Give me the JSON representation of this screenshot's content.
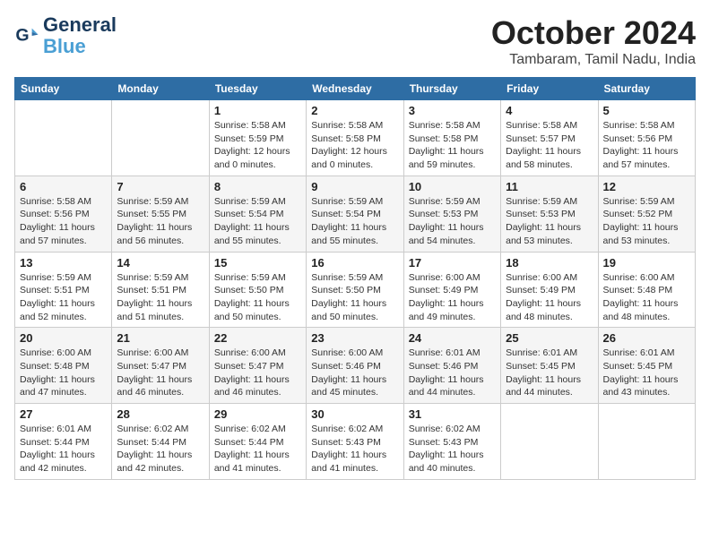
{
  "header": {
    "logo_line1": "General",
    "logo_line2": "Blue",
    "month_title": "October 2024",
    "location": "Tambaram, Tamil Nadu, India"
  },
  "weekdays": [
    "Sunday",
    "Monday",
    "Tuesday",
    "Wednesday",
    "Thursday",
    "Friday",
    "Saturday"
  ],
  "weeks": [
    [
      {
        "day": "",
        "sunrise": "",
        "sunset": "",
        "daylight": ""
      },
      {
        "day": "",
        "sunrise": "",
        "sunset": "",
        "daylight": ""
      },
      {
        "day": "1",
        "sunrise": "Sunrise: 5:58 AM",
        "sunset": "Sunset: 5:59 PM",
        "daylight": "Daylight: 12 hours and 0 minutes."
      },
      {
        "day": "2",
        "sunrise": "Sunrise: 5:58 AM",
        "sunset": "Sunset: 5:58 PM",
        "daylight": "Daylight: 12 hours and 0 minutes."
      },
      {
        "day": "3",
        "sunrise": "Sunrise: 5:58 AM",
        "sunset": "Sunset: 5:58 PM",
        "daylight": "Daylight: 11 hours and 59 minutes."
      },
      {
        "day": "4",
        "sunrise": "Sunrise: 5:58 AM",
        "sunset": "Sunset: 5:57 PM",
        "daylight": "Daylight: 11 hours and 58 minutes."
      },
      {
        "day": "5",
        "sunrise": "Sunrise: 5:58 AM",
        "sunset": "Sunset: 5:56 PM",
        "daylight": "Daylight: 11 hours and 57 minutes."
      }
    ],
    [
      {
        "day": "6",
        "sunrise": "Sunrise: 5:58 AM",
        "sunset": "Sunset: 5:56 PM",
        "daylight": "Daylight: 11 hours and 57 minutes."
      },
      {
        "day": "7",
        "sunrise": "Sunrise: 5:59 AM",
        "sunset": "Sunset: 5:55 PM",
        "daylight": "Daylight: 11 hours and 56 minutes."
      },
      {
        "day": "8",
        "sunrise": "Sunrise: 5:59 AM",
        "sunset": "Sunset: 5:54 PM",
        "daylight": "Daylight: 11 hours and 55 minutes."
      },
      {
        "day": "9",
        "sunrise": "Sunrise: 5:59 AM",
        "sunset": "Sunset: 5:54 PM",
        "daylight": "Daylight: 11 hours and 55 minutes."
      },
      {
        "day": "10",
        "sunrise": "Sunrise: 5:59 AM",
        "sunset": "Sunset: 5:53 PM",
        "daylight": "Daylight: 11 hours and 54 minutes."
      },
      {
        "day": "11",
        "sunrise": "Sunrise: 5:59 AM",
        "sunset": "Sunset: 5:53 PM",
        "daylight": "Daylight: 11 hours and 53 minutes."
      },
      {
        "day": "12",
        "sunrise": "Sunrise: 5:59 AM",
        "sunset": "Sunset: 5:52 PM",
        "daylight": "Daylight: 11 hours and 53 minutes."
      }
    ],
    [
      {
        "day": "13",
        "sunrise": "Sunrise: 5:59 AM",
        "sunset": "Sunset: 5:51 PM",
        "daylight": "Daylight: 11 hours and 52 minutes."
      },
      {
        "day": "14",
        "sunrise": "Sunrise: 5:59 AM",
        "sunset": "Sunset: 5:51 PM",
        "daylight": "Daylight: 11 hours and 51 minutes."
      },
      {
        "day": "15",
        "sunrise": "Sunrise: 5:59 AM",
        "sunset": "Sunset: 5:50 PM",
        "daylight": "Daylight: 11 hours and 50 minutes."
      },
      {
        "day": "16",
        "sunrise": "Sunrise: 5:59 AM",
        "sunset": "Sunset: 5:50 PM",
        "daylight": "Daylight: 11 hours and 50 minutes."
      },
      {
        "day": "17",
        "sunrise": "Sunrise: 6:00 AM",
        "sunset": "Sunset: 5:49 PM",
        "daylight": "Daylight: 11 hours and 49 minutes."
      },
      {
        "day": "18",
        "sunrise": "Sunrise: 6:00 AM",
        "sunset": "Sunset: 5:49 PM",
        "daylight": "Daylight: 11 hours and 48 minutes."
      },
      {
        "day": "19",
        "sunrise": "Sunrise: 6:00 AM",
        "sunset": "Sunset: 5:48 PM",
        "daylight": "Daylight: 11 hours and 48 minutes."
      }
    ],
    [
      {
        "day": "20",
        "sunrise": "Sunrise: 6:00 AM",
        "sunset": "Sunset: 5:48 PM",
        "daylight": "Daylight: 11 hours and 47 minutes."
      },
      {
        "day": "21",
        "sunrise": "Sunrise: 6:00 AM",
        "sunset": "Sunset: 5:47 PM",
        "daylight": "Daylight: 11 hours and 46 minutes."
      },
      {
        "day": "22",
        "sunrise": "Sunrise: 6:00 AM",
        "sunset": "Sunset: 5:47 PM",
        "daylight": "Daylight: 11 hours and 46 minutes."
      },
      {
        "day": "23",
        "sunrise": "Sunrise: 6:00 AM",
        "sunset": "Sunset: 5:46 PM",
        "daylight": "Daylight: 11 hours and 45 minutes."
      },
      {
        "day": "24",
        "sunrise": "Sunrise: 6:01 AM",
        "sunset": "Sunset: 5:46 PM",
        "daylight": "Daylight: 11 hours and 44 minutes."
      },
      {
        "day": "25",
        "sunrise": "Sunrise: 6:01 AM",
        "sunset": "Sunset: 5:45 PM",
        "daylight": "Daylight: 11 hours and 44 minutes."
      },
      {
        "day": "26",
        "sunrise": "Sunrise: 6:01 AM",
        "sunset": "Sunset: 5:45 PM",
        "daylight": "Daylight: 11 hours and 43 minutes."
      }
    ],
    [
      {
        "day": "27",
        "sunrise": "Sunrise: 6:01 AM",
        "sunset": "Sunset: 5:44 PM",
        "daylight": "Daylight: 11 hours and 42 minutes."
      },
      {
        "day": "28",
        "sunrise": "Sunrise: 6:02 AM",
        "sunset": "Sunset: 5:44 PM",
        "daylight": "Daylight: 11 hours and 42 minutes."
      },
      {
        "day": "29",
        "sunrise": "Sunrise: 6:02 AM",
        "sunset": "Sunset: 5:44 PM",
        "daylight": "Daylight: 11 hours and 41 minutes."
      },
      {
        "day": "30",
        "sunrise": "Sunrise: 6:02 AM",
        "sunset": "Sunset: 5:43 PM",
        "daylight": "Daylight: 11 hours and 41 minutes."
      },
      {
        "day": "31",
        "sunrise": "Sunrise: 6:02 AM",
        "sunset": "Sunset: 5:43 PM",
        "daylight": "Daylight: 11 hours and 40 minutes."
      },
      {
        "day": "",
        "sunrise": "",
        "sunset": "",
        "daylight": ""
      },
      {
        "day": "",
        "sunrise": "",
        "sunset": "",
        "daylight": ""
      }
    ]
  ]
}
